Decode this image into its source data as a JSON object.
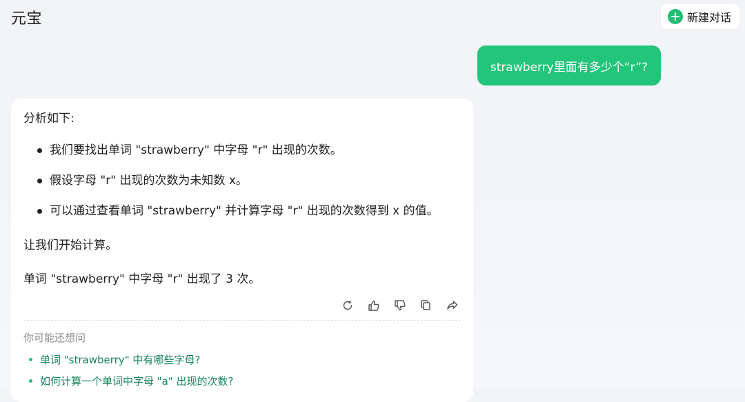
{
  "app": {
    "title": "元宝"
  },
  "header": {
    "new_chat_label": "新建对话"
  },
  "user_message": {
    "text": "strawberry里面有多少个“r”?"
  },
  "answer": {
    "intro": "分析如下:",
    "bullets": [
      "我们要找出单词 \"strawberry\" 中字母 \"r\" 出现的次数。",
      "假设字母 \"r\" 出现的次数为未知数 x。",
      "可以通过查看单词 \"strawberry\" 并计算字母 \"r\" 出现的次数得到 x 的值。"
    ],
    "line_start": "让我们开始计算。",
    "result": "单词 \"strawberry\" 中字母 \"r\" 出现了 3 次。"
  },
  "actions": [
    {
      "icon": "refresh-icon"
    },
    {
      "icon": "thumbs-up-icon"
    },
    {
      "icon": "thumbs-down-icon"
    },
    {
      "icon": "copy-icon"
    },
    {
      "icon": "share-icon"
    }
  ],
  "suggestions": {
    "title": "你可能还想问",
    "items": [
      "单词 \"strawberry\" 中有哪些字母?",
      "如何计算一个单词中字母 \"a\" 出现的次数?"
    ]
  },
  "colors": {
    "accent": "#22c57a",
    "link": "#17845a"
  }
}
